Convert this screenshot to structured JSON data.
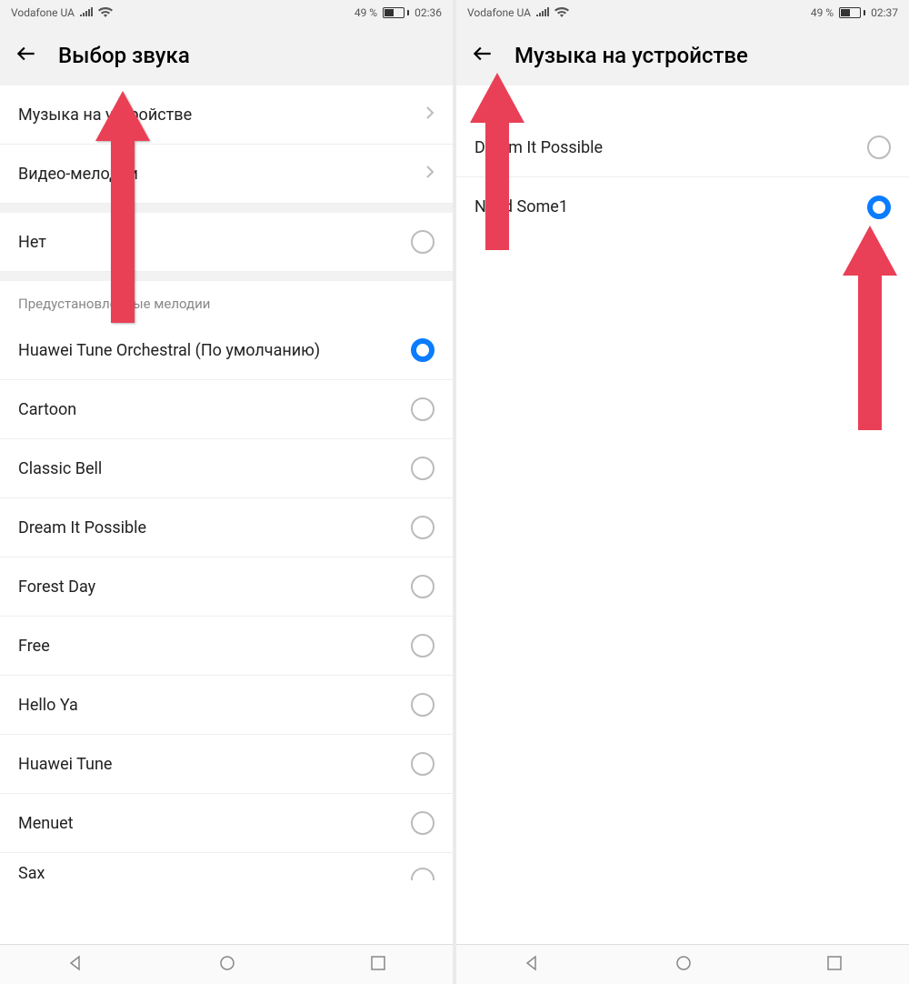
{
  "left": {
    "status": {
      "carrier": "Vodafone UA",
      "battery": "49 %",
      "time": "02:36"
    },
    "header_title": "Выбор звука",
    "nav_items": [
      {
        "label": "Музыка на устройстве"
      },
      {
        "label": "Видео-мелодии"
      }
    ],
    "none_label": "Нет",
    "section_label": "Предустановленные мелодии",
    "ringtones": [
      {
        "label": "Huawei Tune Orchestral (По умолчанию)",
        "selected": true
      },
      {
        "label": "Cartoon",
        "selected": false
      },
      {
        "label": "Classic Bell",
        "selected": false
      },
      {
        "label": "Dream It Possible",
        "selected": false
      },
      {
        "label": "Forest Day",
        "selected": false
      },
      {
        "label": "Free",
        "selected": false
      },
      {
        "label": "Hello Ya",
        "selected": false
      },
      {
        "label": "Huawei Tune",
        "selected": false
      },
      {
        "label": "Menuet",
        "selected": false
      },
      {
        "label": "Sax",
        "selected": false
      }
    ]
  },
  "right": {
    "status": {
      "carrier": "Vodafone UA",
      "battery": "49 %",
      "time": "02:37"
    },
    "header_title": "Музыка на устройстве",
    "songs": [
      {
        "label": "Dream It Possible",
        "selected": false
      },
      {
        "label": "Need Some1",
        "selected": true
      }
    ]
  }
}
